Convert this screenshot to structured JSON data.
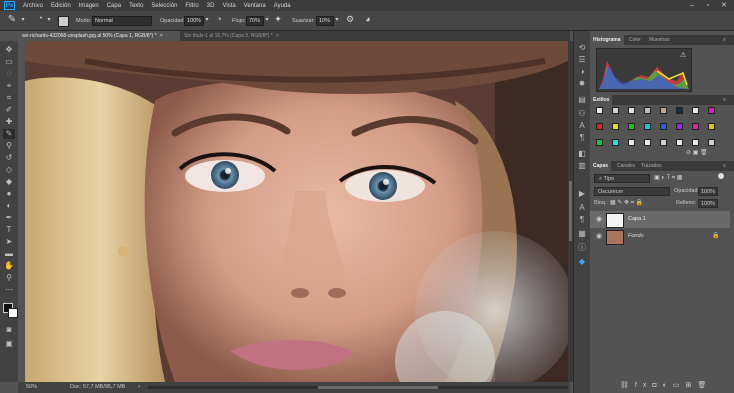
{
  "menu": {
    "items": [
      "Archivo",
      "Edición",
      "Imagen",
      "Capa",
      "Texto",
      "Selección",
      "Filtro",
      "3D",
      "Vista",
      "Ventana",
      "Ayuda"
    ]
  },
  "options": {
    "mode_label": "Modo:",
    "mode_value": "Normal",
    "opacity_label": "Opacidad:",
    "opacity_value": "100%",
    "flow_label": "Flujo:",
    "flow_value": "70%",
    "smooth_label": "Suavizar:",
    "smooth_value": "10%"
  },
  "tabs": [
    {
      "label": "avi-richards-432068-unsplash.jpg al 50% (Capa 1, RGB/8*) *",
      "close": "×"
    },
    {
      "label": "Sin título-1 al 16,7% (Capa 3, RGB/8*) *",
      "close": "×"
    }
  ],
  "status": {
    "zoom": "50%",
    "doc": "Doc: 57,7 MB/95,7 MB"
  },
  "histogram_panel": {
    "tabs": [
      "Histograma",
      "Color",
      "Muestras"
    ]
  },
  "styles_panel": {
    "title": "Estilos"
  },
  "layers_panel": {
    "tabs": [
      "Capas",
      "Canales",
      "Trazados"
    ],
    "filter_value": "Tipo",
    "blend_value": "Oscurecer",
    "opacity_label": "Opacidad:",
    "opacity_value": "100%",
    "lock_label": "Bloq.:",
    "fill_label": "Relleno:",
    "fill_value": "100%",
    "layers": [
      {
        "name": "Capa 1",
        "italic": false,
        "selected": true
      },
      {
        "name": "Fondo",
        "italic": true,
        "selected": false
      }
    ]
  },
  "colors": {
    "accent": "#31a8ff",
    "bg_dark": "#3c3c3c",
    "panel": "#535353"
  }
}
